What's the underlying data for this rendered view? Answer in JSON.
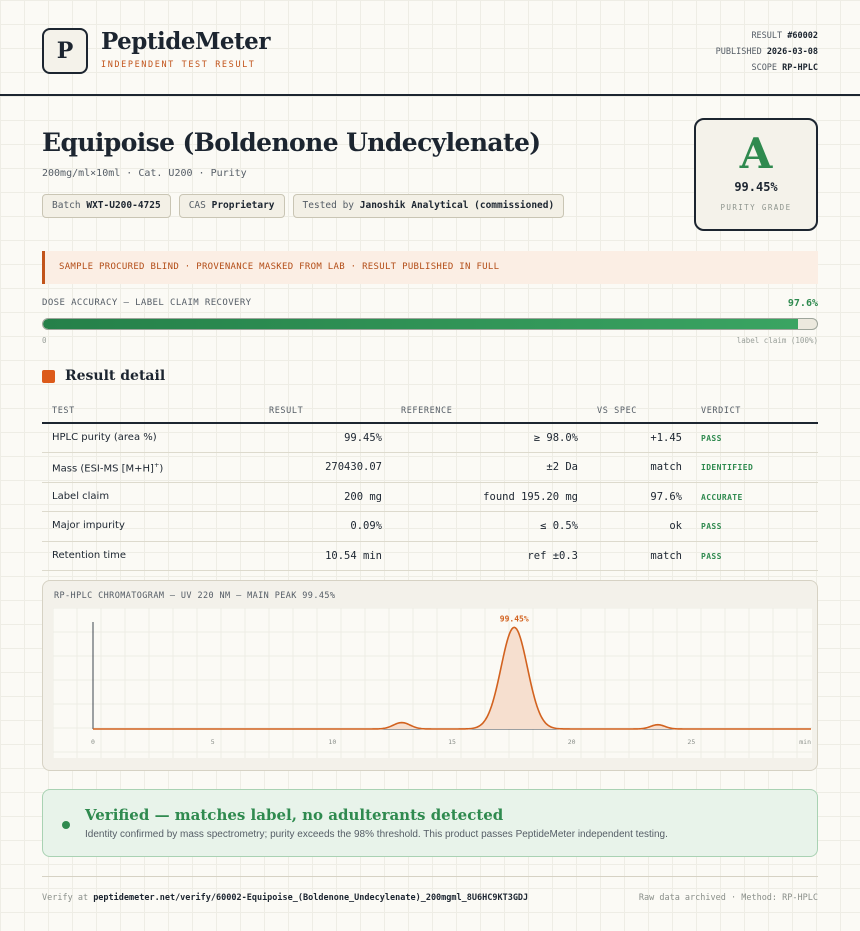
{
  "brand": {
    "logo_letter": "P",
    "name": "PeptideMeter",
    "tagline": "INDEPENDENT TEST RESULT"
  },
  "meta": {
    "result_label": "RESULT",
    "result_value": "#60002",
    "published_label": "PUBLISHED",
    "published_value": "2026-03-08",
    "scope_label": "SCOPE",
    "scope_value": "RP-HPLC"
  },
  "product": {
    "title": "Equipoise (Boldenone Undecylenate)",
    "subtitle": "200mg/ml×10ml · Cat. U200 · Purity",
    "chips": [
      {
        "label": "Batch",
        "value": "WXT-U200-4725"
      },
      {
        "label": "CAS",
        "value": "Proprietary"
      },
      {
        "label": "Tested by",
        "value": "Janoshik Analytical (commissioned)"
      }
    ]
  },
  "grade": {
    "letter": "A",
    "value": "99.45%",
    "label": "PURITY GRADE"
  },
  "banner": "SAMPLE PROCURED BLIND · PROVENANCE MASKED FROM LAB · RESULT PUBLISHED IN FULL",
  "dose": {
    "label": "DOSE ACCURACY — LABEL CLAIM RECOVERY",
    "value": "97.6%",
    "percent": 97.6,
    "min_label": "0",
    "max_label": "label claim (100%)"
  },
  "section_title": "Result detail",
  "table": {
    "headers": {
      "test": "TEST",
      "result": "RESULT",
      "reference": "REFERENCE",
      "vs_spec": "VS SPEC",
      "verdict": "VERDICT"
    },
    "rows": [
      {
        "test": "HPLC purity (area %)",
        "result": "99.45%",
        "reference": "≥ 98.0%",
        "vs": "+1.45",
        "verdict": "PASS"
      },
      {
        "test": "Mass (ESI-MS [M+H]",
        "test_sup": "+",
        "test_end": ")",
        "result": "270430.07",
        "reference": "±2 Da",
        "vs": "match",
        "verdict": "IDENTIFIED"
      },
      {
        "test": "Label claim",
        "result": "200 mg",
        "reference": "found 195.20 mg",
        "vs": "97.6%",
        "verdict": "ACCURATE"
      },
      {
        "test": "Major impurity",
        "result": "0.09%",
        "reference": "≤ 0.5%",
        "vs": "ok",
        "verdict": "PASS"
      },
      {
        "test": "Retention time",
        "result": "10.54 min",
        "reference": "ref ±0.3",
        "vs": "match",
        "verdict": "PASS"
      }
    ]
  },
  "chart_data": {
    "type": "line",
    "title": "RP-HPLC CHROMATOGRAM — UV 220 NM — MAIN PEAK 99.45%",
    "xlabel": "",
    "ylabel": "",
    "x_ticks": [
      "0",
      "5",
      "10",
      "15",
      "20",
      "25"
    ],
    "x_end_label": "min",
    "xlim": [
      0,
      30
    ],
    "ylim": [
      0,
      100
    ],
    "peak_label": "99.45%",
    "peaks": [
      {
        "center": 12.9,
        "height": 6,
        "width": 0.35
      },
      {
        "center": 17.6,
        "height": 95,
        "width": 0.55
      },
      {
        "center": 23.6,
        "height": 4,
        "width": 0.3
      }
    ],
    "baseline": 0,
    "colors": {
      "line": "#d2621f",
      "fill": "#f6dfcf"
    }
  },
  "verified": {
    "title": "Verified — matches label, no adulterants detected",
    "subtitle": "Identity confirmed by mass spectrometry; purity exceeds the 98% threshold. This product passes PeptideMeter independent testing."
  },
  "footer": {
    "verify_prefix": "Verify at",
    "verify_url": "peptidemeter.net/verify/60002-Equipoise_(Boldenone_Undecylenate)_200mgml_8U6HC9KT3GDJ",
    "right": "Raw data archived · Method: RP-HPLC"
  }
}
